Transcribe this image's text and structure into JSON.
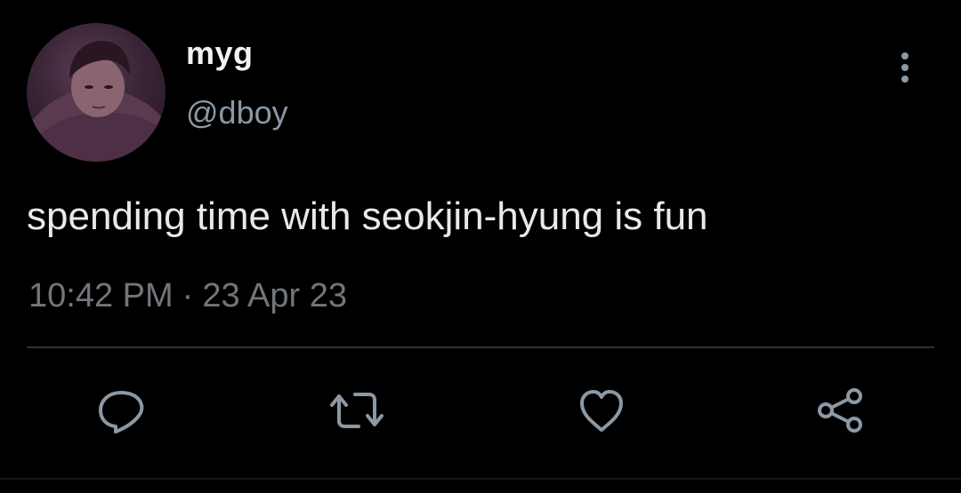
{
  "user": {
    "display_name": "myg",
    "handle": "@dboy",
    "avatar_alt": "profile photo"
  },
  "tweet": {
    "text": "spending time with seokjin-hyung is fun",
    "time": "10:42 PM",
    "separator": "·",
    "date": "23 Apr 23"
  },
  "actions": {
    "reply_icon": "reply-icon",
    "retweet_icon": "retweet-icon",
    "like_icon": "heart-icon",
    "share_icon": "share-icon",
    "more_icon": "more-vertical-icon"
  },
  "colors": {
    "background": "#000000",
    "primary_text": "#e7e9ea",
    "secondary_text": "#8b98a5",
    "divider": "#2f3336"
  }
}
